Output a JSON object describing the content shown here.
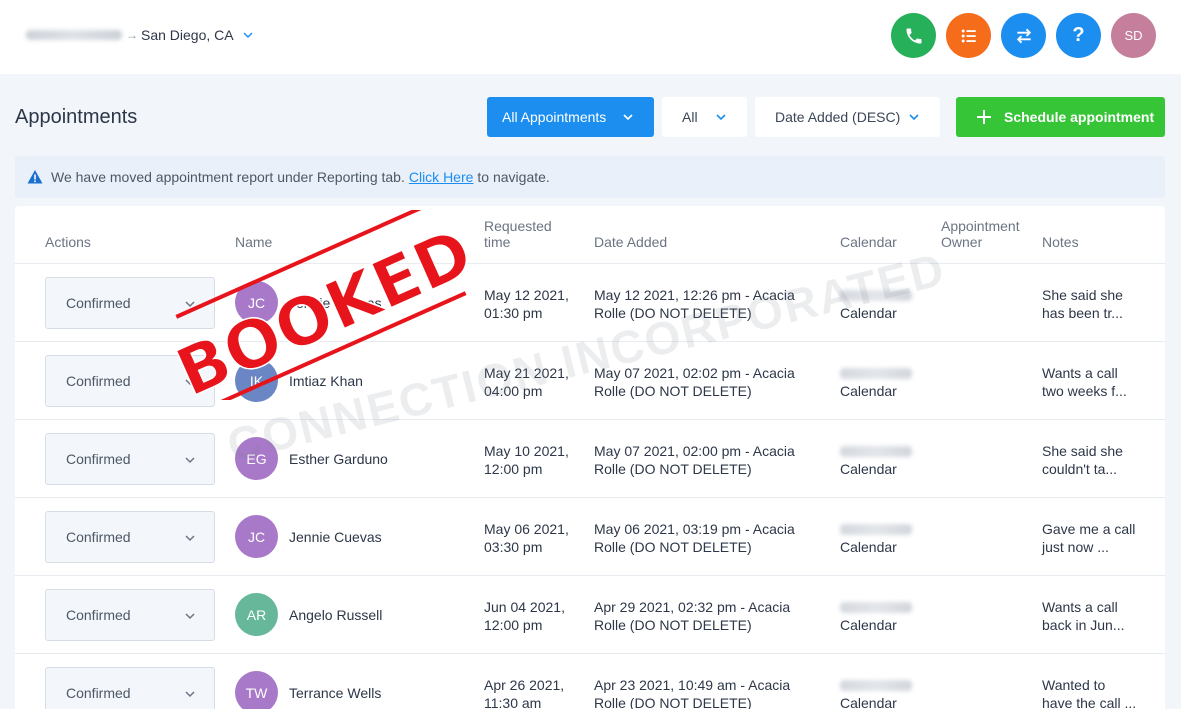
{
  "topbar": {
    "location_prefix": "eMortgageGuys",
    "location_sep": "→",
    "location": "San Diego, CA",
    "avatar_initials": "SD",
    "help_glyph": "?",
    "icons": [
      "phone-icon",
      "list-icon",
      "swap-icon",
      "help-icon"
    ]
  },
  "header": {
    "title": "Appointments",
    "filter_type": "All Appointments",
    "filter_status": "All",
    "sort": "Date Added (DESC)",
    "schedule_label": "Schedule appointment"
  },
  "banner": {
    "text_before": "We have moved appointment report under Reporting tab.",
    "link": "Click Here",
    "text_after": "to navigate."
  },
  "table": {
    "columns": {
      "actions": "Actions",
      "name": "Name",
      "requested_1": "Requested",
      "requested_2": "time",
      "date_added": "Date Added",
      "calendar": "Calendar",
      "owner_1": "Appointment",
      "owner_2": "Owner",
      "notes": "Notes"
    },
    "rows": [
      {
        "status": "Confirmed",
        "initials": "JC",
        "avatar_color": "#a879c9",
        "name": "Jennie Cuevas",
        "req1": "May 12 2021,",
        "req2": "01:30 pm",
        "added1": "May 12 2021, 12:26 pm - Acacia",
        "added2": "Rolle (DO NOT DELETE)",
        "calendar": "Calendar",
        "notes1": "She said she",
        "notes2": "has been tr..."
      },
      {
        "status": "Confirmed",
        "initials": "IK",
        "avatar_color": "#6b86c4",
        "name": "Imtiaz Khan",
        "req1": "May 21 2021,",
        "req2": "04:00 pm",
        "added1": "May 07 2021, 02:02 pm - Acacia",
        "added2": "Rolle (DO NOT DELETE)",
        "calendar": "Calendar",
        "notes1": "Wants a call",
        "notes2": "two weeks f..."
      },
      {
        "status": "Confirmed",
        "initials": "EG",
        "avatar_color": "#a879c9",
        "name": "Esther Garduno",
        "req1": "May 10 2021,",
        "req2": "12:00 pm",
        "added1": "May 07 2021, 02:00 pm - Acacia",
        "added2": "Rolle (DO NOT DELETE)",
        "calendar": "Calendar",
        "notes1": "She said she",
        "notes2": "couldn't ta..."
      },
      {
        "status": "Confirmed",
        "initials": "JC",
        "avatar_color": "#a879c9",
        "name": "Jennie Cuevas",
        "req1": "May 06 2021,",
        "req2": "03:30 pm",
        "added1": "May 06 2021, 03:19 pm - Acacia",
        "added2": "Rolle (DO NOT DELETE)",
        "calendar": "Calendar",
        "notes1": "Gave me a call",
        "notes2": "just now ..."
      },
      {
        "status": "Confirmed",
        "initials": "AR",
        "avatar_color": "#67b79b",
        "name": "Angelo Russell",
        "req1": "Jun 04 2021,",
        "req2": "12:00 pm",
        "added1": "Apr 29 2021, 02:32 pm - Acacia",
        "added2": "Rolle (DO NOT DELETE)",
        "calendar": "Calendar",
        "notes1": "Wants a call",
        "notes2": "back in Jun..."
      },
      {
        "status": "Confirmed",
        "initials": "TW",
        "avatar_color": "#a879c9",
        "name": "Terrance Wells",
        "req1": "Apr 26 2021,",
        "req2": "11:30 am",
        "added1": "Apr 23 2021, 10:49 am - Acacia",
        "added2": "Rolle (DO NOT DELETE)",
        "calendar": "Calendar",
        "notes1": "Wanted to",
        "notes2": "have the call ..."
      }
    ]
  },
  "overlay": {
    "stamp_text": "BOOKED",
    "stamp_color": "#e8141b",
    "watermark": "CONNECTION INCORPORATED"
  },
  "colors": {
    "primary": "#1b8ef0",
    "success": "#35c537",
    "phone": "#26b05a",
    "orange": "#f56c1b"
  }
}
